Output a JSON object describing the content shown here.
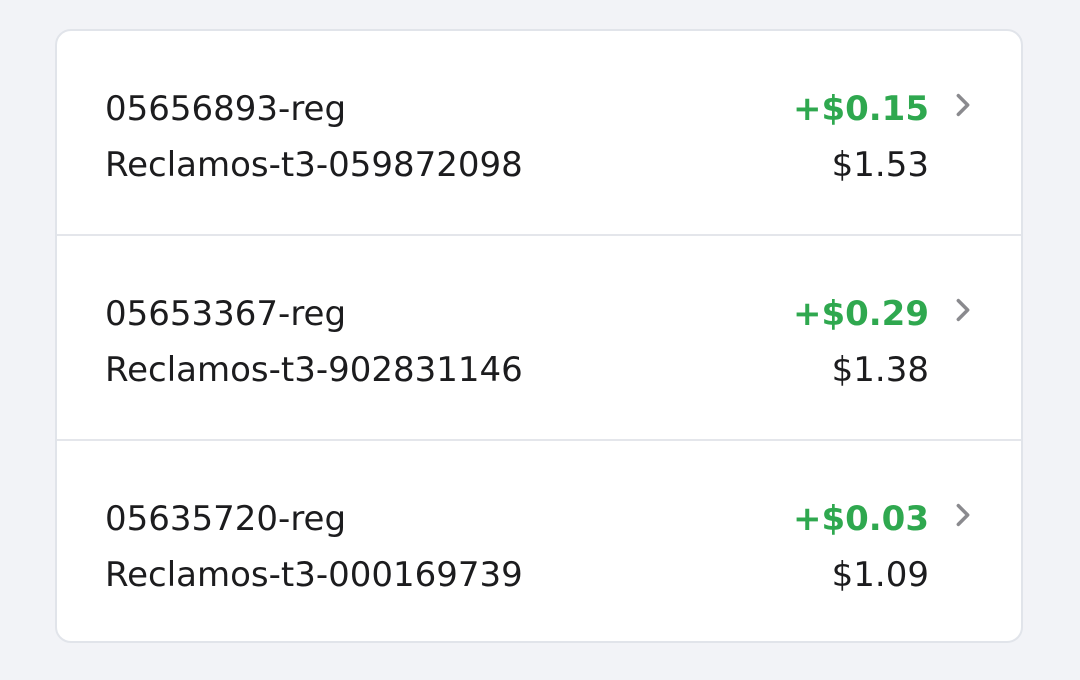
{
  "colors": {
    "background": "#f2f3f7",
    "card": "#ffffff",
    "positive": "#2fa84f",
    "text": "#1c1c1e",
    "chevron": "#8a8a8e"
  },
  "transactions": [
    {
      "title": "05656893-reg",
      "subtitle": "Reclamos-t3-059872098",
      "delta": "+$0.15",
      "total": "$1.53",
      "icon": "chevron-right-icon"
    },
    {
      "title": "05653367-reg",
      "subtitle": "Reclamos-t3-902831146",
      "delta": "+$0.29",
      "total": "$1.38",
      "icon": "chevron-right-icon"
    },
    {
      "title": "05635720-reg",
      "subtitle": "Reclamos-t3-000169739",
      "delta": "+$0.03",
      "total": "$1.09",
      "icon": "chevron-right-icon"
    }
  ]
}
